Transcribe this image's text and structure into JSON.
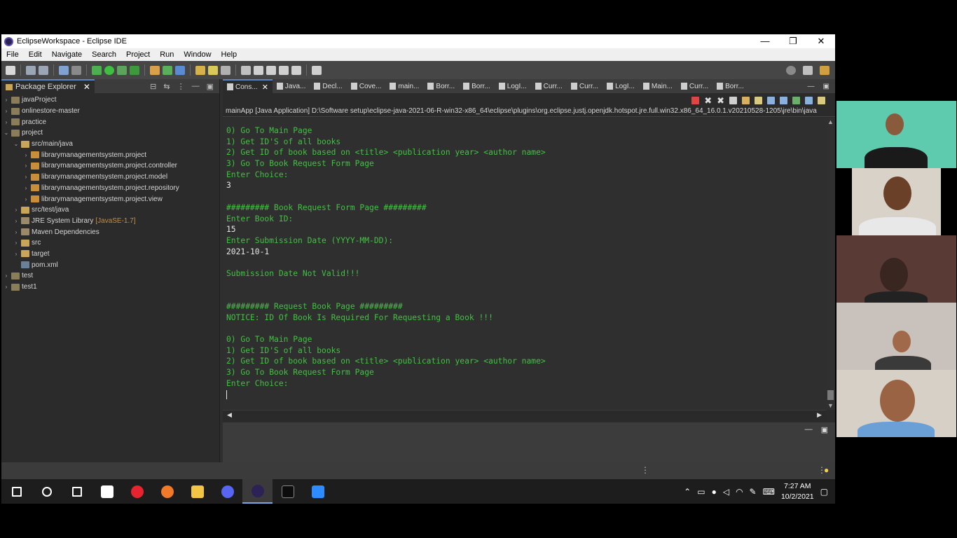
{
  "window": {
    "title": "EclipseWorkspace - Eclipse IDE",
    "controls": [
      "—",
      "❐",
      "✕"
    ]
  },
  "menu": [
    "File",
    "Edit",
    "Navigate",
    "Search",
    "Project",
    "Run",
    "Window",
    "Help"
  ],
  "package_explorer": {
    "title": "Package Explorer",
    "tree": [
      {
        "label": "javaProject",
        "depth": 0,
        "icon": "project-icon",
        "expand": "›"
      },
      {
        "label": "onlinestore-master",
        "depth": 0,
        "icon": "project-icon",
        "expand": "›"
      },
      {
        "label": "practice",
        "depth": 0,
        "icon": "project-icon",
        "expand": "›"
      },
      {
        "label": "project",
        "depth": 0,
        "icon": "project-icon",
        "expand": "⌄"
      },
      {
        "label": "src/main/java",
        "depth": 1,
        "icon": "source-folder-icon",
        "expand": "⌄"
      },
      {
        "label": "librarymanagementsystem.project",
        "depth": 2,
        "icon": "package-icon",
        "expand": "›"
      },
      {
        "label": "librarymanagementsystem.project.controller",
        "depth": 2,
        "icon": "package-icon",
        "expand": "›"
      },
      {
        "label": "librarymanagementsystem.project.model",
        "depth": 2,
        "icon": "package-icon",
        "expand": "›"
      },
      {
        "label": "librarymanagementsystem.project.repository",
        "depth": 2,
        "icon": "package-icon",
        "expand": "›"
      },
      {
        "label": "librarymanagementsystem.project.view",
        "depth": 2,
        "icon": "package-icon",
        "expand": "›"
      },
      {
        "label": "src/test/java",
        "depth": 1,
        "icon": "source-folder-icon",
        "expand": "›"
      },
      {
        "label": "JRE System Library",
        "extra": "[JavaSE-1.7]",
        "depth": 1,
        "icon": "library-icon",
        "expand": "›"
      },
      {
        "label": "Maven Dependencies",
        "depth": 1,
        "icon": "library-icon",
        "expand": "›"
      },
      {
        "label": "src",
        "depth": 1,
        "icon": "folder-icon",
        "expand": "›"
      },
      {
        "label": "target",
        "depth": 1,
        "icon": "folder-icon",
        "expand": "›"
      },
      {
        "label": "pom.xml",
        "depth": 1,
        "icon": "file-icon",
        "expand": ""
      },
      {
        "label": "test",
        "depth": 0,
        "icon": "project-icon",
        "expand": "›"
      },
      {
        "label": "test1",
        "depth": 0,
        "icon": "project-icon",
        "expand": "›"
      }
    ]
  },
  "editor_tabs": [
    {
      "label": "Cons...",
      "active": true
    },
    {
      "label": "Java...",
      "active": false
    },
    {
      "label": "Decl...",
      "active": false
    },
    {
      "label": "Cove...",
      "active": false
    },
    {
      "label": "main...",
      "active": false
    },
    {
      "label": "Borr...",
      "active": false
    },
    {
      "label": "Borr...",
      "active": false
    },
    {
      "label": "LogI...",
      "active": false
    },
    {
      "label": "Curr...",
      "active": false
    },
    {
      "label": "Curr...",
      "active": false
    },
    {
      "label": "LogI...",
      "active": false
    },
    {
      "label": "Main...",
      "active": false
    },
    {
      "label": "Curr...",
      "active": false
    },
    {
      "label": "Borr...",
      "active": false
    }
  ],
  "console": {
    "launch_line": "mainApp [Java Application] D:\\Software setup\\eclipse-java-2021-06-R-win32-x86_64\\eclipse\\plugins\\org.eclipse.justj.openjdk.hotspot.jre.full.win32.x86_64_16.0.1.v20210528-1205\\jre\\bin\\java",
    "lines": [
      {
        "text": "0) Go To Main Page",
        "kind": "output"
      },
      {
        "text": "1) Get ID'S of all books",
        "kind": "output"
      },
      {
        "text": "2) Get ID of book based on <title> <publication year> <author name>",
        "kind": "output"
      },
      {
        "text": "3) Go To Book Request Form Page",
        "kind": "output"
      },
      {
        "text": "Enter Choice:",
        "kind": "output"
      },
      {
        "text": "3",
        "kind": "input"
      },
      {
        "text": "",
        "kind": "output"
      },
      {
        "text": "######### Book Request Form Page #########",
        "kind": "output"
      },
      {
        "text": "Enter Book ID:",
        "kind": "output"
      },
      {
        "text": "15",
        "kind": "input"
      },
      {
        "text": "Enter Submission Date (YYYY-MM-DD):",
        "kind": "output"
      },
      {
        "text": "2021-10-1",
        "kind": "input"
      },
      {
        "text": "",
        "kind": "output"
      },
      {
        "text": "Submission Date Not Valid!!!",
        "kind": "output"
      },
      {
        "text": "",
        "kind": "output"
      },
      {
        "text": "",
        "kind": "output"
      },
      {
        "text": "######### Request Book Page #########",
        "kind": "output"
      },
      {
        "text": "NOTICE: ID Of Book Is Required For Requesting a Book !!!",
        "kind": "output"
      },
      {
        "text": "",
        "kind": "output"
      },
      {
        "text": "0) Go To Main Page",
        "kind": "output"
      },
      {
        "text": "1) Get ID'S of all books",
        "kind": "output"
      },
      {
        "text": "2) Get ID of book based on <title> <publication year> <author name>",
        "kind": "output"
      },
      {
        "text": "3) Go To Book Request Form Page",
        "kind": "output"
      },
      {
        "text": "Enter Choice:",
        "kind": "output"
      }
    ],
    "output_color": "#42c142",
    "input_color": "#e8e8e8"
  },
  "taskbar": {
    "apps": [
      {
        "name": "windows-start-icon",
        "color": "#ffffff"
      },
      {
        "name": "search-icon",
        "color": "#ffffff"
      },
      {
        "name": "task-view-icon",
        "color": "#ffffff"
      },
      {
        "name": "store-icon",
        "color": "#ffffff"
      },
      {
        "name": "opera-icon",
        "color": "#e5242f"
      },
      {
        "name": "firefox-icon",
        "color": "#f07a2a"
      },
      {
        "name": "file-explorer-icon",
        "color": "#f3c545"
      },
      {
        "name": "discord-icon",
        "color": "#5865f2"
      },
      {
        "name": "eclipse-icon",
        "color": "#2c2255"
      },
      {
        "name": "terminal-icon",
        "color": "#0c0c0c"
      },
      {
        "name": "zoom-icon",
        "color": "#2d8cff"
      }
    ],
    "time": "7:27 AM",
    "date": "10/2/2021"
  },
  "video_tiles": [
    {
      "name": "participant-1",
      "bg": "#5fcbae",
      "skin": "#8a5a3c",
      "shirt": "#1a1a1a"
    },
    {
      "name": "participant-2",
      "bg": "#d8d2c8",
      "skin": "#6b4028",
      "shirt": "#e8e8e8"
    },
    {
      "name": "participant-3",
      "bg": "#5a3a34",
      "skin": "#3a2620",
      "shirt": "#222"
    },
    {
      "name": "participant-4",
      "bg": "#c9c2bc",
      "skin": "#a06a4a",
      "shirt": "#3a3a3a"
    },
    {
      "name": "participant-5",
      "bg": "#d6d0c6",
      "skin": "#9a6444",
      "shirt": "#6aa0d6"
    }
  ]
}
